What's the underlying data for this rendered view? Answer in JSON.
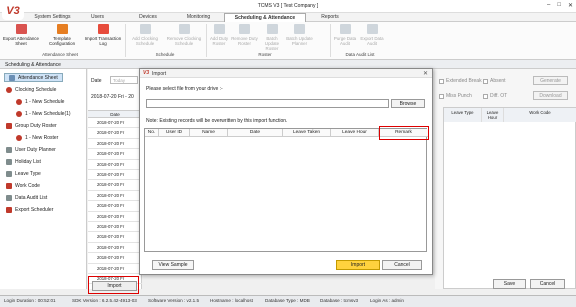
{
  "app": {
    "title": "TCMS V3 [ Test Company ]",
    "logo": "V3"
  },
  "tabs": [
    "System Settings",
    "Users",
    "Devices",
    "Monitoring",
    "Scheduling & Attendance",
    "Reports"
  ],
  "ribbon": {
    "buttons": [
      "Export Attendance Sheet",
      "Template Configuration",
      "Import Transaction Log",
      "Add Clocking Schedule",
      "Remove Clocking Schedule",
      "Add Duty Roster",
      "Remove Duty Roster",
      "Batch Update Roster",
      "Batch Update Planner",
      "Purge Data Audit",
      "Export Data Audit"
    ],
    "groups": [
      "Attendance Sheet",
      "Schedule",
      "Roster",
      "Data Audit List"
    ]
  },
  "pane_title": "Scheduling & Attendance",
  "sidebar": [
    "Attendance Sheet",
    "Clocking Schedule",
    "1 - New Schedule",
    "1 - New Schedule(1)",
    "Group Duty Roster",
    "1 - New Roster",
    "User Duty Planner",
    "Holiday List",
    "Leave Type",
    "Work Code",
    "Data Audit List",
    "Export Scheduler"
  ],
  "mid": {
    "date_label": "Date",
    "date_placeholder": "Today",
    "date_range": "2018-07-20 Fri - 20",
    "col_header": "Date",
    "rows": [
      "2018-07-20 Fr",
      "2018-07-20 Fr",
      "2018-07-20 Fr",
      "2018-07-20 Fr",
      "2018-07-20 Fr",
      "2018-07-20 Fr",
      "2018-07-20 Fr",
      "2018-07-20 Fr",
      "2018-07-20 Fr",
      "2018-07-20 Fr",
      "2018-07-20 Fr",
      "2018-07-20 Fr",
      "2018-07-20 Fr",
      "2018-07-20 Fr",
      "2018-07-20 Fr",
      "2018-07-20 Fr"
    ],
    "import_label": "Import"
  },
  "right": {
    "extended_break": "Extended Break",
    "absent": "Absent",
    "miss_punch": "Miss Punch",
    "diff_ot": "Diff. OT",
    "generate": "Generate",
    "download": "Download",
    "cols": [
      "Leave Type",
      "Leave Hour",
      "Work Code"
    ],
    "save": "Save",
    "cancel": "Cancel"
  },
  "dialog": {
    "title": "Import",
    "instruction": "Please select file from your drive :-",
    "browse": "Browse",
    "note": "Note: Existing records will be overwritten by this import function.",
    "columns": [
      "No.",
      "User ID",
      "Name",
      "Date",
      "Leave Taken",
      "Leave Hour",
      "Remark"
    ],
    "view_sample": "View Sample",
    "import": "Import",
    "cancel": "Cancel"
  },
  "status": [
    "Login Duration : 00:52:01",
    "SDK Version : 6.2.5.42-4913-03",
    "Software Version : v2.1.5",
    "Hostname : localhost",
    "Database Type : MDB",
    "Database : tcmsv3",
    "Login As : admin"
  ]
}
